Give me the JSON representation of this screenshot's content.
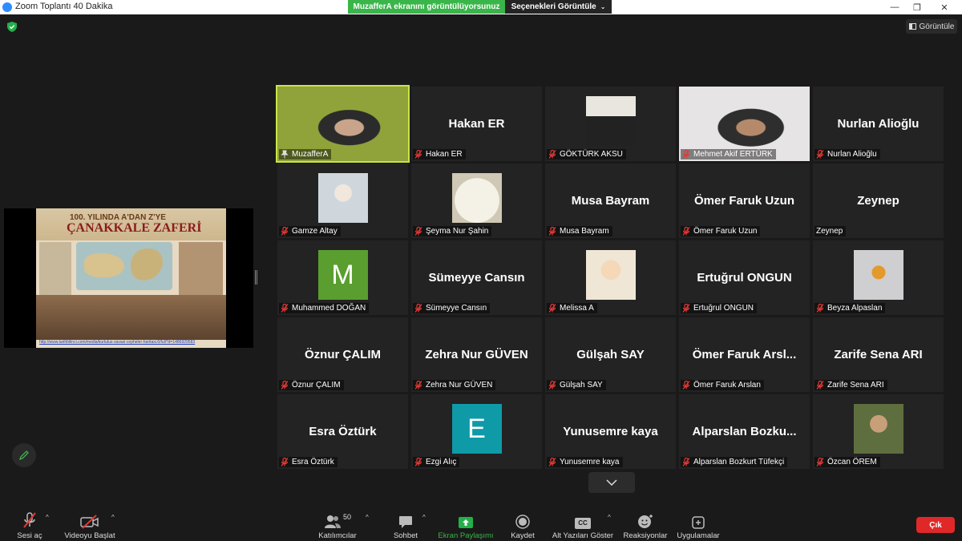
{
  "window": {
    "title": "Zoom Toplantı 40 Dakika"
  },
  "banner": {
    "sharing_message": "MuzafferA ekranını görüntülüyorsunuz",
    "view_options": "Seçenekleri Görüntüle"
  },
  "view_button": {
    "label": "Görüntüle"
  },
  "shared_screen": {
    "title_line1": "100. YILINDA A'DAN Z'YE",
    "title_line2": "ÇANAKKALE ZAFERİ",
    "link": "http://www.tarihbilinci.com/media/kurtulus-savasi-cepheler-haritasi.6/full?d=1486929583"
  },
  "participants": [
    {
      "name": "MuzafferA",
      "display": "",
      "kind": "video",
      "active": true
    },
    {
      "name": "Hakan ER",
      "display": "Hakan ER",
      "kind": "name"
    },
    {
      "name": "GÖKTÜRK AKSU",
      "display": "",
      "kind": "photo"
    },
    {
      "name": "Mehmet Akif ERTÜRK",
      "display": "",
      "kind": "video"
    },
    {
      "name": "Nurlan Alioğlu",
      "display": "Nurlan Alioğlu",
      "kind": "name"
    },
    {
      "name": "Gamze Altay",
      "display": "",
      "kind": "photo"
    },
    {
      "name": "Şeyma Nur Şahin",
      "display": "",
      "kind": "photo"
    },
    {
      "name": "Musa Bayram",
      "display": "Musa Bayram",
      "kind": "name"
    },
    {
      "name": "Ömer Faruk Uzun",
      "display": "Ömer Faruk Uzun",
      "kind": "name"
    },
    {
      "name": "Zeynep",
      "display": "Zeynep",
      "kind": "name",
      "unmuted": true
    },
    {
      "name": "Muhammed DOĞAN",
      "display": "M",
      "kind": "letter",
      "color": "#5a9e2f"
    },
    {
      "name": "Sümeyye Cansın",
      "display": "Sümeyye Cansın",
      "kind": "name"
    },
    {
      "name": "Melissa A",
      "display": "",
      "kind": "photo"
    },
    {
      "name": "Ertuğrul ONGUN",
      "display": "Ertuğrul ONGUN",
      "kind": "name"
    },
    {
      "name": "Beyza Alpaslan",
      "display": "",
      "kind": "photo"
    },
    {
      "name": "Öznur ÇALIM",
      "display": "Öznur ÇALIM",
      "kind": "name"
    },
    {
      "name": "Zehra Nur GÜVEN",
      "display": "Zehra Nur GÜVEN",
      "kind": "name"
    },
    {
      "name": "Gülşah SAY",
      "display": "Gülşah SAY",
      "kind": "name"
    },
    {
      "name": "Ömer Faruk Arslan",
      "display": "Ömer Faruk Arsl...",
      "kind": "name"
    },
    {
      "name": "Zarife Sena ARI",
      "display": "Zarife Sena ARI",
      "kind": "name"
    },
    {
      "name": "Esra Öztürk",
      "display": "Esra Öztürk",
      "kind": "name"
    },
    {
      "name": "Ezgi Alıç",
      "display": "E",
      "kind": "letter",
      "color": "#0f9aa8"
    },
    {
      "name": "Yunusemre kaya",
      "display": "Yunusemre kaya",
      "kind": "name"
    },
    {
      "name": "Alparslan Bozkurt Tüfekçi",
      "display": "Alparslan Bozku...",
      "kind": "name"
    },
    {
      "name": "Özcan ÖREM",
      "display": "",
      "kind": "photo"
    }
  ],
  "toolbar": {
    "mic": "Sesi aç",
    "video": "Videoyu Başlat",
    "participants": "Katılımcılar",
    "participants_count": "50",
    "chat": "Sohbet",
    "share": "Ekran Paylaşımı",
    "record": "Kaydet",
    "captions": "Alt Yazıları Göster",
    "captions_icon": "CC",
    "reactions": "Reaksiyonlar",
    "apps": "Uygulamalar",
    "leave": "Çık"
  },
  "colors": {
    "share_green": "#3ab54a",
    "active_speaker": "#c9e44a",
    "leave_red": "#e02828"
  }
}
